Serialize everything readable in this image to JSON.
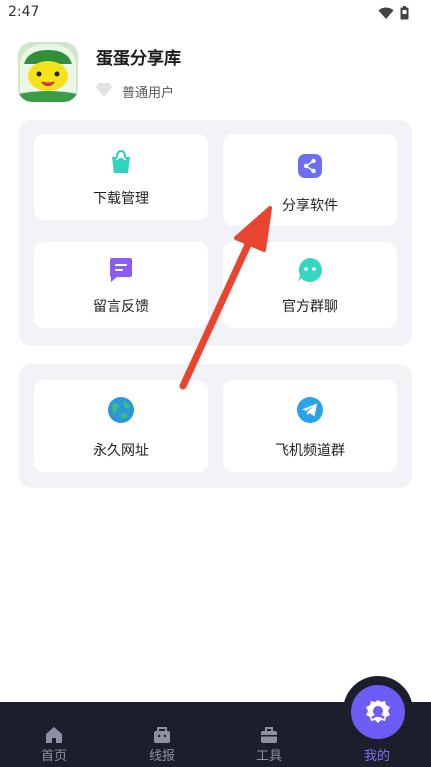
{
  "status_bar": {
    "time": "2:47",
    "wifi_icon": "wifi-icon",
    "battery_icon": "battery-icon"
  },
  "profile": {
    "app_name": "蛋蛋分享库",
    "user_level": "普通用户",
    "level_icon": "diamond-icon"
  },
  "menu_primary": [
    {
      "label": "下载管理",
      "icon": "shopping-bag-icon",
      "color": "#2fd3c0"
    },
    {
      "label": "分享软件",
      "icon": "share-icon",
      "color": "#6e6ef5"
    },
    {
      "label": "留言反馈",
      "icon": "message-icon",
      "color": "#8a5cf5"
    },
    {
      "label": "官方群聊",
      "icon": "chat-face-icon",
      "color": "#35d6c3"
    }
  ],
  "menu_secondary": [
    {
      "label": "永久网址",
      "icon": "globe-icon",
      "color": "#2a97e0"
    },
    {
      "label": "飞机频道群",
      "icon": "telegram-icon",
      "color": "#2aa3e8"
    }
  ],
  "bottom_nav": [
    {
      "label": "首页",
      "icon": "home-icon"
    },
    {
      "label": "线报",
      "icon": "bag-icon"
    },
    {
      "label": "工具",
      "icon": "toolbox-icon"
    },
    {
      "label": "我的",
      "icon": "profile-gear-icon",
      "active": true
    }
  ],
  "colors": {
    "accent": "#6b5cf6",
    "nav_background": "#1c1f2b",
    "annotation_arrow": "#e8442f"
  }
}
